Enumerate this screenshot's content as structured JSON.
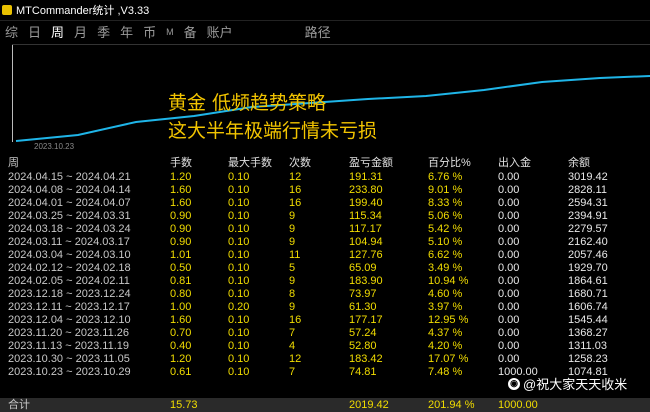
{
  "window": {
    "title": "MTCommander统计 ,V3.33"
  },
  "tabs": [
    "综",
    "日",
    "周",
    "月",
    "季",
    "年",
    "币",
    "M",
    "备",
    "账户"
  ],
  "path_label": "路径",
  "chart": {
    "start_date": "2023.10.23",
    "line_color": "#1fb5e8"
  },
  "overlay": {
    "line1": "黄金   低频趋势策略",
    "line2": "这大半年极端行情未亏损"
  },
  "table": {
    "headers": [
      "周",
      "手数",
      "最大手数",
      "次数",
      "盈亏金额",
      "百分比%",
      "出入金",
      "余额"
    ],
    "rows": [
      [
        "2024.04.15 ~ 2024.04.21",
        "1.20",
        "0.10",
        "12",
        "191.31",
        "6.76 %",
        "0.00",
        "3019.42"
      ],
      [
        "2024.04.08 ~ 2024.04.14",
        "1.60",
        "0.10",
        "16",
        "233.80",
        "9.01 %",
        "0.00",
        "2828.11"
      ],
      [
        "2024.04.01 ~ 2024.04.07",
        "1.60",
        "0.10",
        "16",
        "199.40",
        "8.33 %",
        "0.00",
        "2594.31"
      ],
      [
        "2024.03.25 ~ 2024.03.31",
        "0.90",
        "0.10",
        "9",
        "115.34",
        "5.06 %",
        "0.00",
        "2394.91"
      ],
      [
        "2024.03.18 ~ 2024.03.24",
        "0.90",
        "0.10",
        "9",
        "117.17",
        "5.42 %",
        "0.00",
        "2279.57"
      ],
      [
        "2024.03.11 ~ 2024.03.17",
        "0.90",
        "0.10",
        "9",
        "104.94",
        "5.10 %",
        "0.00",
        "2162.40"
      ],
      [
        "2024.03.04 ~ 2024.03.10",
        "1.01",
        "0.10",
        "11",
        "127.76",
        "6.62 %",
        "0.00",
        "2057.46"
      ],
      [
        "2024.02.12 ~ 2024.02.18",
        "0.50",
        "0.10",
        "5",
        "65.09",
        "3.49 %",
        "0.00",
        "1929.70"
      ],
      [
        "2024.02.05 ~ 2024.02.11",
        "0.81",
        "0.10",
        "9",
        "183.90",
        "10.94 %",
        "0.00",
        "1864.61"
      ],
      [
        "2023.12.18 ~ 2023.12.24",
        "0.80",
        "0.10",
        "8",
        "73.97",
        "4.60 %",
        "0.00",
        "1680.71"
      ],
      [
        "2023.12.11 ~ 2023.12.17",
        "1.00",
        "0.20",
        "9",
        "61.30",
        "3.97 %",
        "0.00",
        "1606.74"
      ],
      [
        "2023.12.04 ~ 2023.12.10",
        "1.60",
        "0.10",
        "16",
        "177.17",
        "12.95 %",
        "0.00",
        "1545.44"
      ],
      [
        "2023.11.20 ~ 2023.11.26",
        "0.70",
        "0.10",
        "7",
        "57.24",
        "4.37 %",
        "0.00",
        "1368.27"
      ],
      [
        "2023.11.13 ~ 2023.11.19",
        "0.40",
        "0.10",
        "4",
        "52.80",
        "4.20 %",
        "0.00",
        "1311.03"
      ],
      [
        "2023.10.30 ~ 2023.11.05",
        "1.20",
        "0.10",
        "12",
        "183.42",
        "17.07 %",
        "0.00",
        "1258.23"
      ],
      [
        "2023.10.23 ~ 2023.10.29",
        "0.61",
        "0.10",
        "7",
        "74.81",
        "7.48 %",
        "1000.00",
        "1074.81"
      ]
    ],
    "total": [
      "合计",
      "15.73",
      "",
      "",
      "2019.42",
      "201.94 %",
      "1000.00",
      ""
    ]
  },
  "watermark": {
    "icon": "weibo-icon",
    "text": "@祝大家天天收米"
  }
}
